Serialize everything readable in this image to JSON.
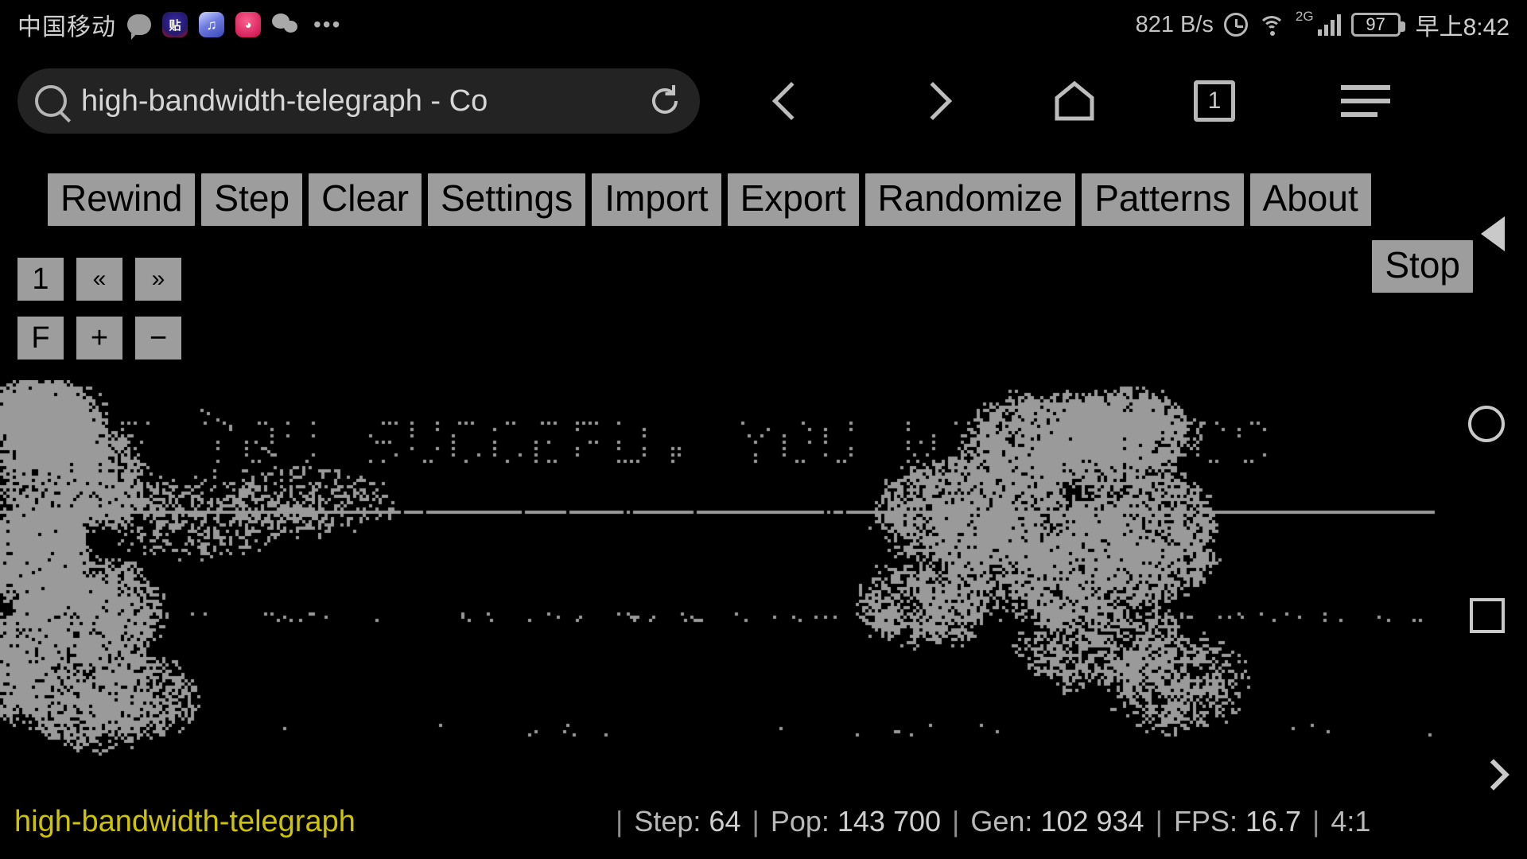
{
  "status_bar": {
    "carrier": "中国移动",
    "icons": [
      "message-bubble-icon",
      "tieba-app-icon",
      "music-app-icon",
      "pink-app-icon",
      "wechat-icon",
      "overflow-dots-icon"
    ],
    "net_speed": "821 B/s",
    "alarm": "alarm-icon",
    "wifi": "wifi-icon",
    "network_type": "2G",
    "signal": "signal-bars-icon",
    "battery_percent": "97",
    "clock": "早上8:42"
  },
  "browser": {
    "url_text": "high-bandwidth-telegraph - Co",
    "search_icon": "search-icon",
    "reload_icon": "reload-icon",
    "back_icon": "chevron-left-icon",
    "forward_icon": "chevron-right-icon",
    "home_icon": "home-icon",
    "tab_count": "1",
    "menu_icon": "hamburger-menu-icon"
  },
  "app": {
    "toolbar_buttons": [
      "Rewind",
      "Step",
      "Clear",
      "Settings",
      "Import",
      "Export",
      "Randomize",
      "Patterns",
      "About"
    ],
    "stop_button": "Stop",
    "speed_buttons": [
      "1",
      "«",
      "»"
    ],
    "view_buttons": [
      "F",
      "+",
      "−"
    ]
  },
  "canvas": {
    "rendered_text": "...IF YOU SUCCEED, YOU WILL SUCC",
    "cell_color": "#9a9a9a",
    "background": "#000000"
  },
  "bottom_status": {
    "site_name": "high-bandwidth-telegraph",
    "site_name_color": "#cfc400",
    "items": [
      {
        "label": "Step:",
        "value": "64"
      },
      {
        "label": "Pop:",
        "value": "143 700"
      },
      {
        "label": "Gen:",
        "value": "102 934"
      },
      {
        "label": "FPS:",
        "value": "16.7"
      }
    ],
    "ratio": "4:1"
  },
  "system_nav": {
    "back": "triangle-back-icon",
    "home": "circle-home-icon",
    "recents": "square-recents-icon",
    "forward": "chevron-right-icon"
  }
}
